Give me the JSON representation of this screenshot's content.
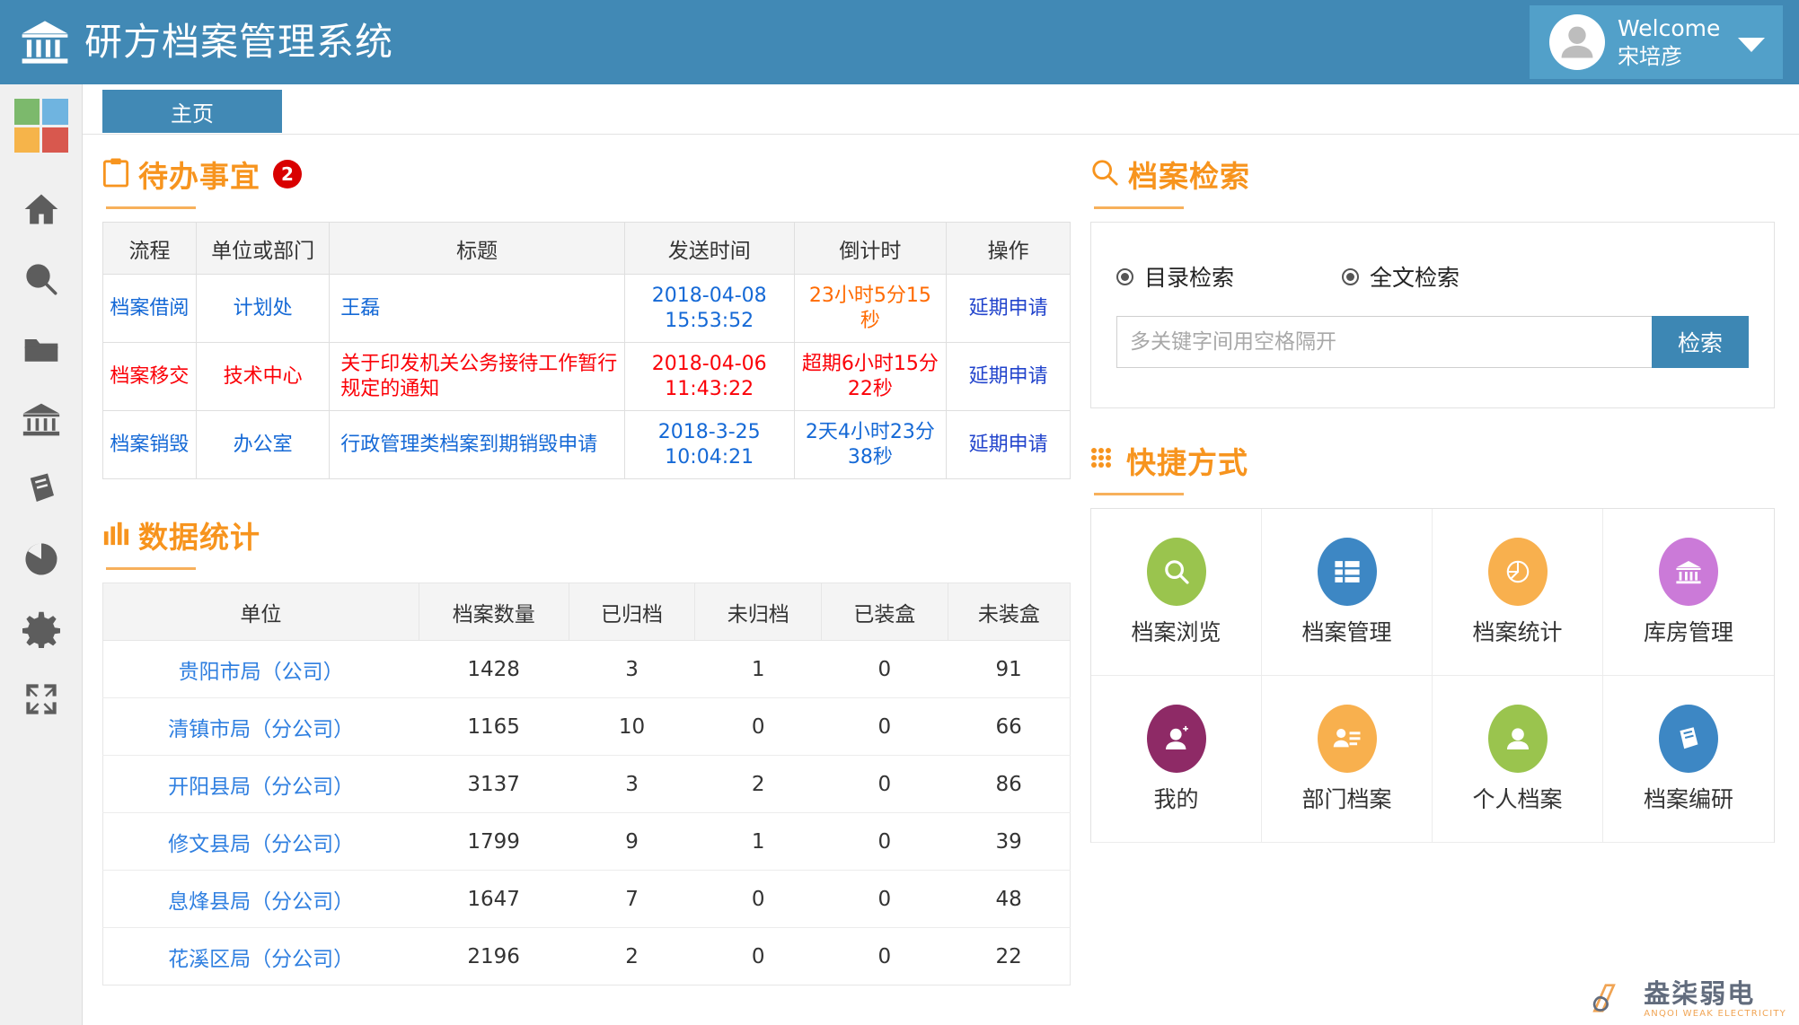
{
  "header": {
    "title": "研方档案管理系统",
    "logo_icon": "bank-icon",
    "user": {
      "greeting": "Welcome",
      "name": "宋培彦",
      "avatar_icon": "user-avatar-icon",
      "caret_icon": "chevron-down-icon"
    },
    "background_color": "#4189b5",
    "user_box_color": "#52a0c9"
  },
  "sidebar": {
    "logo_tiles": [
      "#7cb96c",
      "#6fb4e0",
      "#f6b44a",
      "#d8584e"
    ],
    "items": [
      {
        "name": "home-icon",
        "label": "首页"
      },
      {
        "name": "search-icon",
        "label": "检索"
      },
      {
        "name": "folder-icon",
        "label": "档案"
      },
      {
        "name": "bank-icon",
        "label": "库房"
      },
      {
        "name": "book-icon",
        "label": "编研"
      },
      {
        "name": "pie-chart-icon",
        "label": "统计"
      },
      {
        "name": "gear-icon",
        "label": "设置"
      },
      {
        "name": "fullscreen-icon",
        "label": "全屏"
      }
    ]
  },
  "tabs": [
    {
      "label": "主页",
      "active": true
    }
  ],
  "todo": {
    "title": "待办事宜",
    "icon": "clipboard-icon",
    "count": "2",
    "columns": [
      "流程",
      "单位或部门",
      "标题",
      "发送时间",
      "倒计时",
      "操作"
    ],
    "rows": [
      {
        "flow": "档案借阅",
        "dept": "计划处",
        "title": "王磊",
        "send_time": "2018-04-08 15:53:52",
        "countdown": "23小时5分15秒",
        "action": "延期申请",
        "row_color": "#1569d6",
        "countdown_color": "#ff6a00"
      },
      {
        "flow": "档案移交",
        "dept": "技术中心",
        "title": "关于印发机关公务接待工作暂行规定的通知",
        "send_time": "2018-04-06 11:43:22",
        "countdown": "超期6小时15分22秒",
        "action": "延期申请",
        "row_color": "#fb0007",
        "countdown_color": "#fb0007"
      },
      {
        "flow": "档案销毁",
        "dept": "办公室",
        "title": "行政管理类档案到期销毁申请",
        "send_time": "2018-3-25 10:04:21",
        "countdown": "2天4小时23分38秒",
        "action": "延期申请",
        "row_color": "#1569d6",
        "countdown_color": "#1569d6"
      }
    ]
  },
  "stats": {
    "title": "数据统计",
    "icon": "bar-chart-icon",
    "columns": [
      "单位",
      "档案数量",
      "已归档",
      "未归档",
      "已装盒",
      "未装盒"
    ],
    "rows": [
      {
        "unit": "贵阳市局（公司）",
        "total": "1428",
        "archived": "3",
        "unarchived": "1",
        "boxed": "0",
        "unboxed": "91"
      },
      {
        "unit": "清镇市局（分公司）",
        "total": "1165",
        "archived": "10",
        "unarchived": "0",
        "boxed": "0",
        "unboxed": "66"
      },
      {
        "unit": "开阳县局（分公司）",
        "total": "3137",
        "archived": "3",
        "unarchived": "2",
        "boxed": "0",
        "unboxed": "86"
      },
      {
        "unit": "修文县局（分公司）",
        "total": "1799",
        "archived": "9",
        "unarchived": "1",
        "boxed": "0",
        "unboxed": "39"
      },
      {
        "unit": "息烽县局（分公司）",
        "total": "1647",
        "archived": "7",
        "unarchived": "0",
        "boxed": "0",
        "unboxed": "48"
      },
      {
        "unit": "花溪区局（分公司）",
        "total": "2196",
        "archived": "2",
        "unarchived": "0",
        "boxed": "0",
        "unboxed": "22"
      }
    ]
  },
  "search": {
    "title": "档案检索",
    "icon": "search-icon",
    "options": [
      {
        "label": "目录检索",
        "selected": true
      },
      {
        "label": "全文检索",
        "selected": true
      }
    ],
    "placeholder": "多关键字间用空格隔开",
    "value": "",
    "button_label": "检索",
    "button_color": "#3d87b4"
  },
  "shortcuts": {
    "title": "快捷方式",
    "icon": "grid-dots-icon",
    "items": [
      {
        "label": "档案浏览",
        "icon": "search-circle-icon",
        "color": "#9ac44e"
      },
      {
        "label": "档案管理",
        "icon": "table-icon",
        "color": "#3d87c4"
      },
      {
        "label": "档案统计",
        "icon": "pie-chart-icon",
        "color": "#f8b04e"
      },
      {
        "label": "库房管理",
        "icon": "bank-icon",
        "color": "#cb7ad8"
      },
      {
        "label": "我的",
        "icon": "user-add-icon",
        "color": "#8e2a66"
      },
      {
        "label": "部门档案",
        "icon": "users-card-icon",
        "color": "#f8b04e"
      },
      {
        "label": "个人档案",
        "icon": "user-icon",
        "color": "#9ac44e"
      },
      {
        "label": "档案编研",
        "icon": "book-icon",
        "color": "#3d87c4"
      }
    ]
  },
  "watermark": {
    "cn": "盎柒弱电",
    "en": "ANQOI WEAK ELECTRICITY"
  },
  "theme": {
    "accent_orange": "#f7941e",
    "brand_blue": "#4189b5",
    "link_blue": "#1569d6",
    "alert_red": "#d90000"
  }
}
